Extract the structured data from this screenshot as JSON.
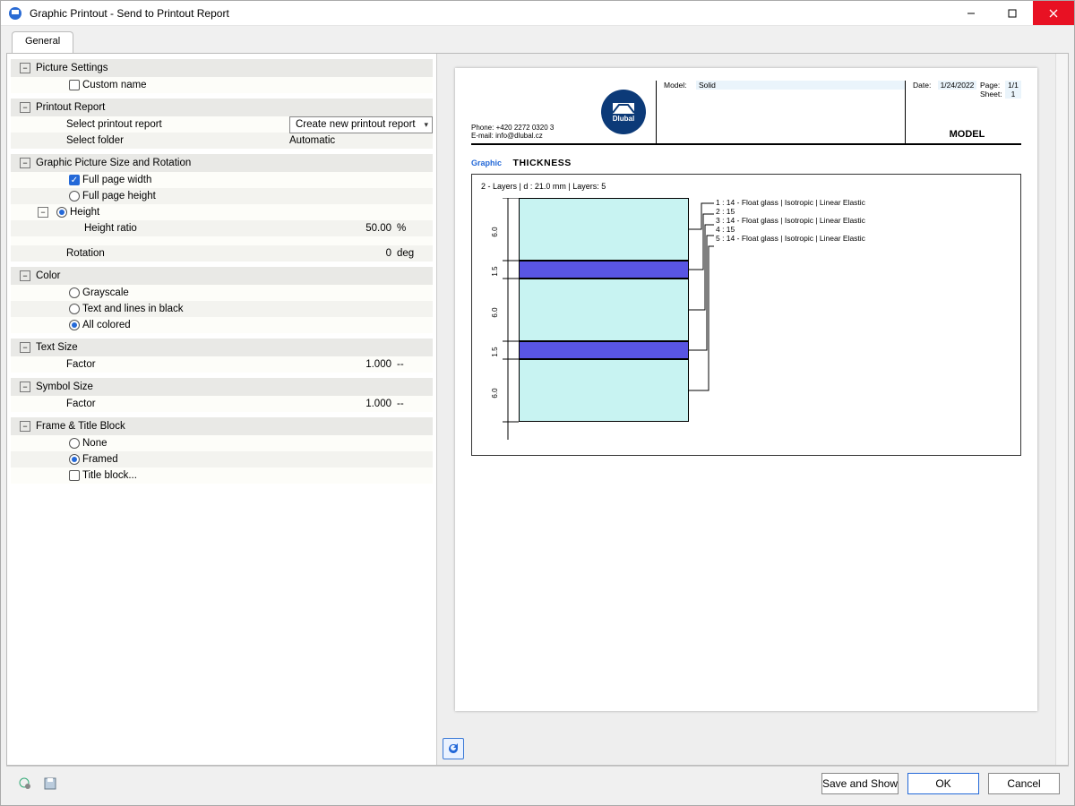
{
  "window": {
    "title": "Graphic Printout - Send to Printout Report"
  },
  "tab": {
    "general": "General"
  },
  "sections": {
    "picture_settings": {
      "title": "Picture Settings",
      "custom_name": "Custom name"
    },
    "printout_report": {
      "title": "Printout Report",
      "select_report": "Select printout report",
      "select_report_value": "Create new printout report",
      "select_folder": "Select folder",
      "select_folder_value": "Automatic"
    },
    "size_rotation": {
      "title": "Graphic Picture Size and Rotation",
      "full_width": "Full page width",
      "full_height": "Full page height",
      "height": "Height",
      "height_ratio": "Height ratio",
      "height_ratio_value": "50.00",
      "height_ratio_unit": "%",
      "rotation": "Rotation",
      "rotation_value": "0",
      "rotation_unit": "deg"
    },
    "color": {
      "title": "Color",
      "grayscale": "Grayscale",
      "bw": "Text and lines in black",
      "all": "All colored"
    },
    "text_size": {
      "title": "Text Size",
      "factor": "Factor",
      "value": "1.000",
      "unit": "--"
    },
    "symbol_size": {
      "title": "Symbol Size",
      "factor": "Factor",
      "value": "1.000",
      "unit": "--"
    },
    "frame": {
      "title": "Frame & Title Block",
      "none": "None",
      "framed": "Framed",
      "title_block": "Title block..."
    }
  },
  "report": {
    "contact_phone": "Phone: +420 2272 0320 3",
    "contact_email": "E-mail: info@dlubal.cz",
    "logo_text": "Dlubal",
    "model_label": "Model:",
    "model_value": "Solid",
    "date_label": "Date:",
    "date_value": "1/24/2022",
    "page_label": "Page:",
    "page_value": "1/1",
    "sheet_label": "Sheet:",
    "sheet_value": "1",
    "model_big": "MODEL",
    "caption_prefix": "Graphic",
    "caption_title": "THICKNESS",
    "subtitle": "2 - Layers | d : 21.0 mm | Layers: 5",
    "layer_dims": [
      "6.0",
      "1.5",
      "6.0",
      "1.5",
      "6.0"
    ],
    "callouts": [
      "1 : 14 - Float glass | Isotropic | Linear Elastic",
      "2 : 15",
      "3 : 14 - Float glass | Isotropic | Linear Elastic",
      "4 : 15",
      "5 : 14 - Float glass | Isotropic | Linear Elastic"
    ]
  },
  "footer": {
    "save_show": "Save and Show",
    "ok": "OK",
    "cancel": "Cancel"
  }
}
